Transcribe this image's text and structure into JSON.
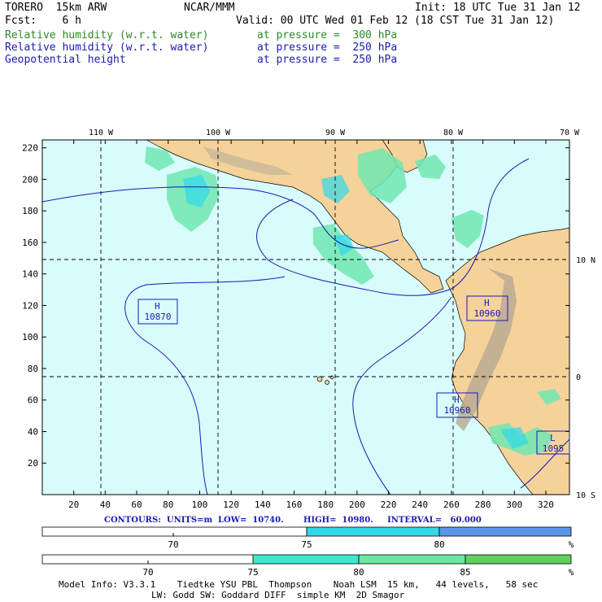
{
  "header": {
    "model": "TORERO  15km ARW",
    "center": "NCAR/MMM",
    "init": "Init: 18 UTC Tue 31 Jan 12",
    "fcst": "Fcst:    6 h",
    "valid": "Valid: 00 UTC Wed 01 Feb 12 (18 CST Tue 31 Jan 12)"
  },
  "fields": [
    {
      "name": "Relative humidity (w.r.t. water)",
      "level": "at pressure =  300 hPa",
      "color": "#2a8a2a"
    },
    {
      "name": "Relative humidity (w.r.t. water)",
      "level": "at pressure =  250 hPa",
      "color": "#1a1ab0"
    },
    {
      "name": "Geopotential height",
      "level": "at pressure =  250 hPa",
      "color": "#1a1ab0"
    }
  ],
  "axes": {
    "x_ticks": [
      "20",
      "40",
      "60",
      "80",
      "100",
      "120",
      "140",
      "160",
      "180",
      "200",
      "220",
      "240",
      "260",
      "280",
      "300",
      "320"
    ],
    "y_ticks": [
      "20",
      "40",
      "60",
      "80",
      "100",
      "120",
      "140",
      "160",
      "180",
      "200",
      "220"
    ],
    "lon_labels": [
      "110 W",
      "100 W",
      "90 W",
      "80 W",
      "70 W"
    ],
    "lat_labels": [
      "10 N",
      "0",
      "10 S"
    ]
  },
  "highs": [
    {
      "label": "H",
      "value": "10870"
    },
    {
      "label": "H",
      "value": "10960"
    },
    {
      "label": "H",
      "value": "10960"
    },
    {
      "label": "L",
      "value": "1095"
    }
  ],
  "contour_info": "CONTOURS:  UNITS=m  LOW=  10740.       HIGH=  10980.     INTERVAL=   60.000",
  "colorbar1": {
    "labels": [
      "70",
      "75",
      "80",
      "%"
    ],
    "colors": [
      "#ffffff",
      "#30d8e8",
      "#5a96e8"
    ]
  },
  "colorbar2": {
    "labels": [
      "70",
      "75",
      "80",
      "85",
      "%"
    ],
    "colors": [
      "#ffffff",
      "#40e8d0",
      "#68e8a0",
      "#60d060"
    ]
  },
  "footer": {
    "line1": "Model Info: V3.3.1    Tiedtke YSU PBL  Thompson    Noah LSM  15 km,   44 levels,   58 sec",
    "line2": "LW: Godd SW: Goddard DIFF  simple KM  2D Smagor"
  }
}
